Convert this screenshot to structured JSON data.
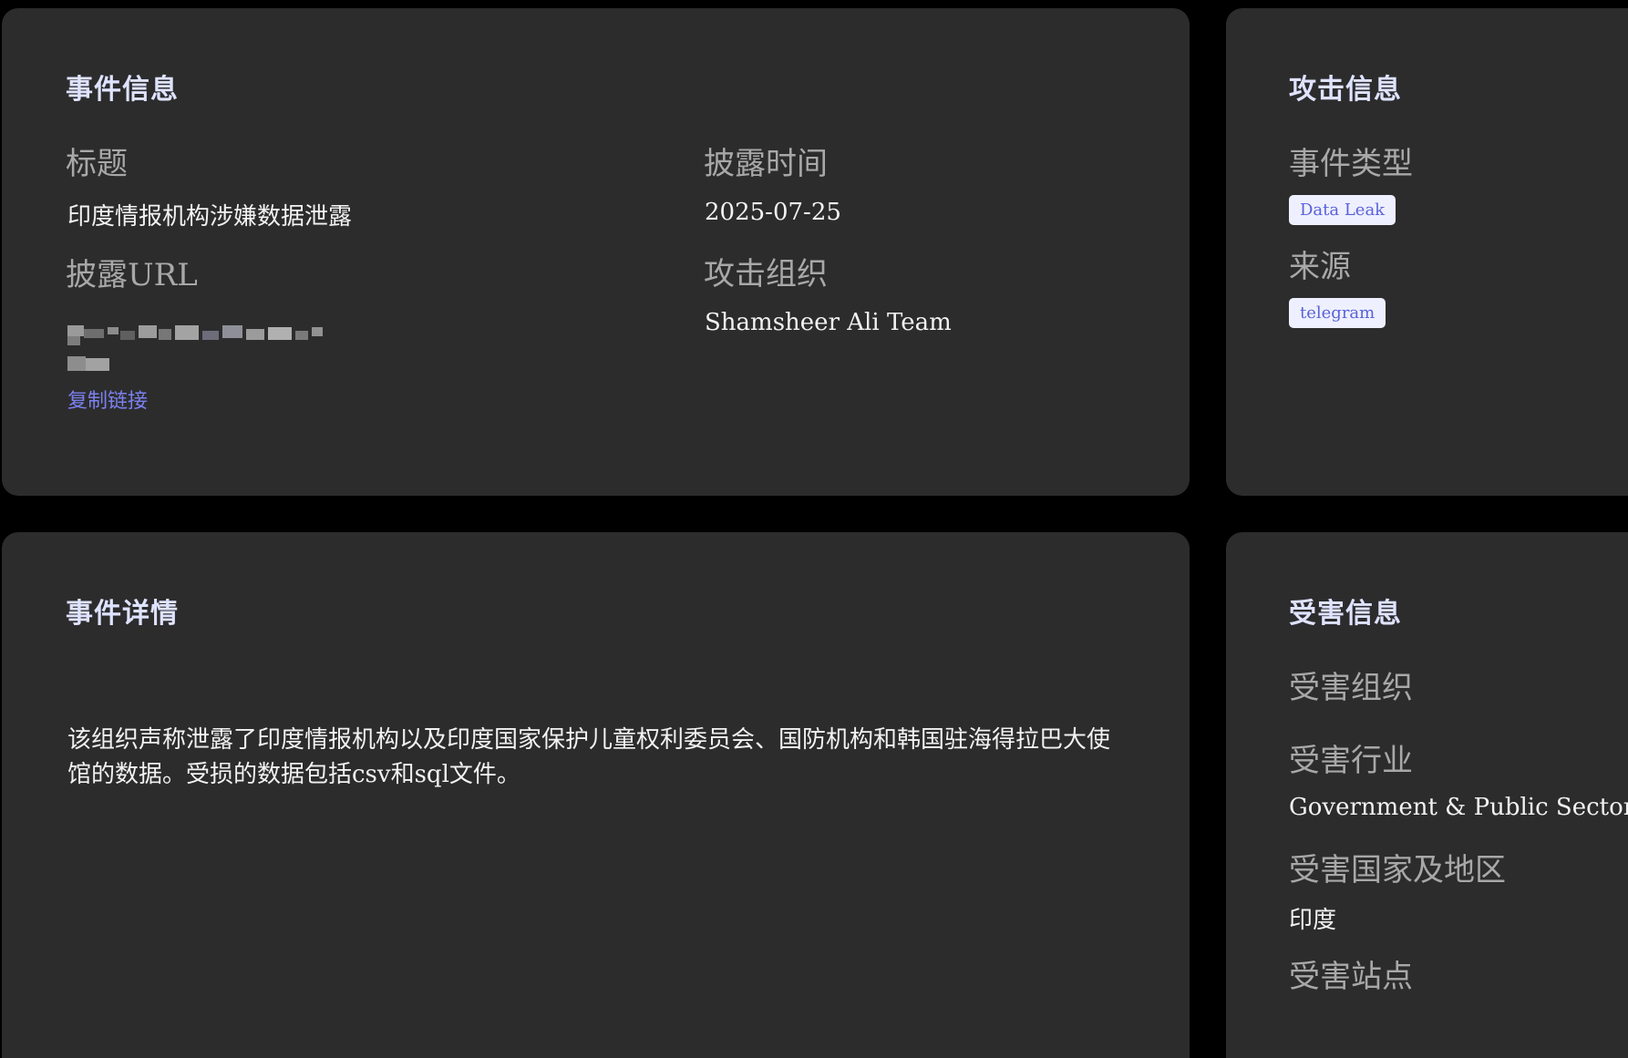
{
  "event_info": {
    "title": "事件信息",
    "title_label": "标题",
    "title_value": "印度情报机构涉嫌数据泄露",
    "disclosure_time_label": "披露时间",
    "disclosure_time_value": "2025-07-25",
    "disclosure_url_label": "披露URL",
    "copy_link_label": "复制链接",
    "attack_group_label": "攻击组织",
    "attack_group_value": "Shamsheer Ali Team"
  },
  "attack_info": {
    "title": "攻击信息",
    "event_type_label": "事件类型",
    "event_type_tag": "Data Leak",
    "source_label": "来源",
    "source_tag": "telegram"
  },
  "event_detail": {
    "title": "事件详情",
    "description": "该组织声称泄露了印度情报机构以及印度国家保护儿童权利委员会、国防机构和韩国驻海得拉巴大使馆的数据。受损的数据包括csv和sql文件。"
  },
  "victim_info": {
    "title": "受害信息",
    "victim_org_label": "受害组织",
    "victim_industry_label": "受害行业",
    "victim_industry_value": "Government & Public Sector",
    "victim_region_label": "受害国家及地区",
    "victim_region_value": "印度",
    "victim_site_label": "受害站点"
  },
  "colors": {
    "page_bg": "#000000",
    "card_bg": "#2c2c2d",
    "accent": "#7b80ee",
    "tag_bg": "#eef0ff"
  }
}
